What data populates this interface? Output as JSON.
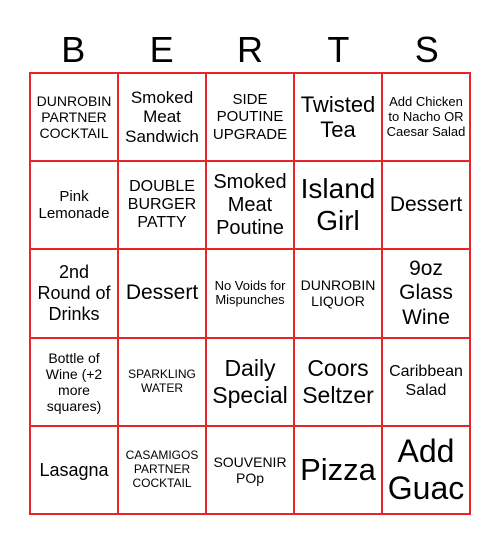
{
  "header": [
    "B",
    "E",
    "R",
    "T",
    "S"
  ],
  "accent_color": "#e8232a",
  "cells": [
    [
      "DUNROBIN PARTNER COCKTAIL",
      "Smoked Meat Sandwich",
      "SIDE POUTINE UPGRADE",
      "Twisted Tea",
      "Add Chicken to Nacho OR Caesar Salad"
    ],
    [
      "Pink Lemonade",
      "DOUBLE BURGER PATTY",
      "Smoked Meat Poutine",
      "Island Girl",
      "Dessert"
    ],
    [
      "2nd Round of Drinks",
      "Dessert",
      "No Voids for Mispunches",
      "DUNROBIN LIQUOR",
      "9oz Glass Wine"
    ],
    [
      "Bottle of Wine (+2 more squares)",
      "SPARKLING WATER",
      "Daily Special",
      "Coors Seltzer",
      "Caribbean Salad"
    ],
    [
      "Lasagna",
      "CASAMIGOS PARTNER COCKTAIL",
      "SOUVENIR POp",
      "Pizza",
      "Add Guac"
    ]
  ]
}
